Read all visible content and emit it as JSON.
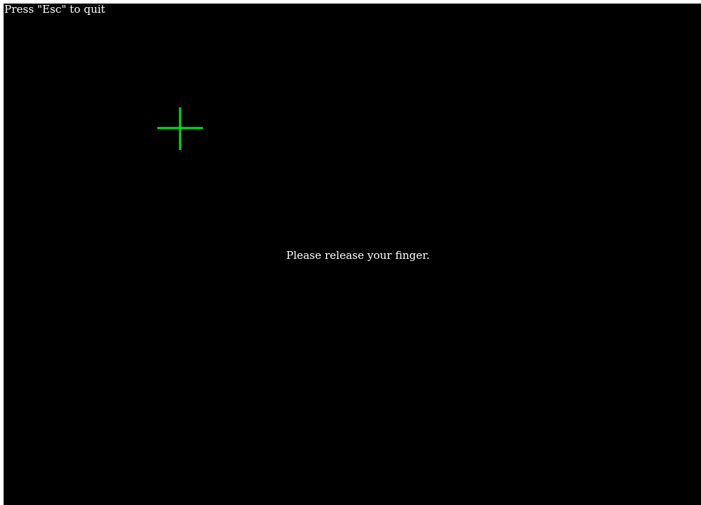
{
  "hint": {
    "text": "Press \"Esc\" to quit"
  },
  "target": {
    "icon": "crosshair-icon",
    "color": "#00e020"
  },
  "instruction": {
    "text": "Please release your finger."
  },
  "colors": {
    "background": "#000000",
    "text": "#ffffff"
  }
}
